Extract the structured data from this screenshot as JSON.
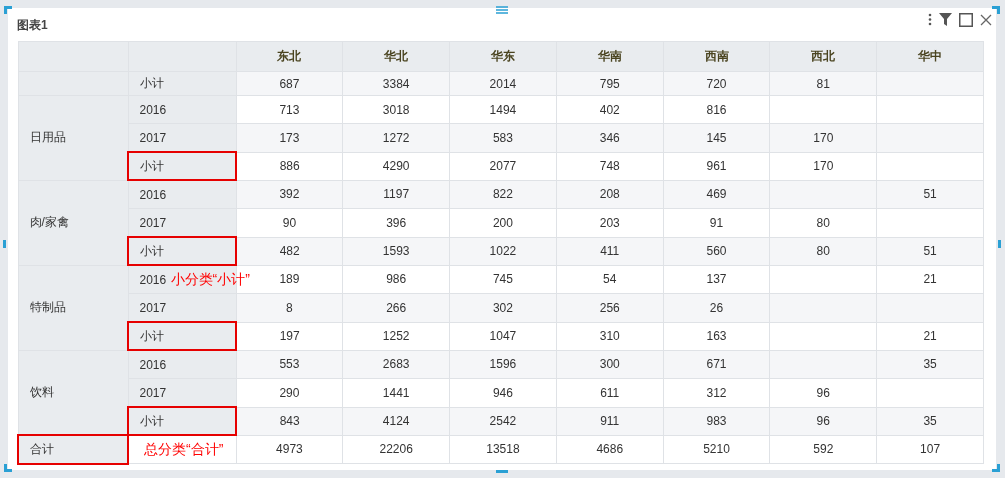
{
  "panel": {
    "title": "图表1"
  },
  "toolbar": [
    {
      "kind": "more"
    },
    {
      "kind": "filter"
    },
    {
      "kind": "maximize"
    },
    {
      "kind": "close"
    }
  ],
  "table": {
    "columns": [
      "东北",
      "华北",
      "华东",
      "华南",
      "西南",
      "西北",
      "华中"
    ],
    "groups": [
      {
        "rows": [
          {
            "label": "小计",
            "highlighted": false,
            "values": {
              "col_1": "687",
              "col_2": "3384",
              "col_3": "2014",
              "col_4": "795",
              "col_5": "720",
              "col_6": "81"
            }
          }
        ]
      },
      {
        "category": "日用品",
        "rows": [
          {
            "label": "2016",
            "highlighted": false,
            "values": {
              "col_1": "713",
              "col_2": "3018",
              "col_3": "1494",
              "col_4": "402",
              "col_5": "816"
            }
          },
          {
            "label": "2017",
            "highlighted": false,
            "values": {
              "col_1": "173",
              "col_2": "1272",
              "col_3": "583",
              "col_4": "346",
              "col_5": "145",
              "col_6": "170"
            }
          },
          {
            "label": "小计",
            "highlighted": true,
            "values": {
              "col_1": "886",
              "col_2": "4290",
              "col_3": "2077",
              "col_4": "748",
              "col_5": "961",
              "col_6": "170"
            }
          }
        ]
      },
      {
        "category": "肉/家禽",
        "rows": [
          {
            "label": "2016",
            "highlighted": false,
            "values": {
              "col_1": "392",
              "col_2": "1197",
              "col_3": "822",
              "col_4": "208",
              "col_5": "469",
              "col_7": "51"
            }
          },
          {
            "label": "2017",
            "highlighted": false,
            "values": {
              "col_1": "90",
              "col_2": "396",
              "col_3": "200",
              "col_4": "203",
              "col_5": "91",
              "col_6": "80"
            }
          },
          {
            "label": "小计",
            "highlighted": true,
            "values": {
              "col_1": "482",
              "col_2": "1593",
              "col_3": "1022",
              "col_4": "411",
              "col_5": "560",
              "col_6": "80",
              "col_7": "51"
            }
          }
        ]
      },
      {
        "category": "特制品",
        "rows": [
          {
            "label": "2016",
            "highlighted": false,
            "note": "小分类“小计”",
            "values": {
              "col_1": "189",
              "col_2": "986",
              "col_3": "745",
              "col_4": "54",
              "col_5": "137",
              "col_7": "21"
            }
          },
          {
            "label": "2017",
            "highlighted": false,
            "values": {
              "col_1": "8",
              "col_2": "266",
              "col_3": "302",
              "col_4": "256",
              "col_5": "26"
            }
          },
          {
            "label": "小计",
            "highlighted": true,
            "values": {
              "col_1": "197",
              "col_2": "1252",
              "col_3": "1047",
              "col_4": "310",
              "col_5": "163",
              "col_7": "21"
            }
          }
        ]
      },
      {
        "category": "饮料",
        "rows": [
          {
            "label": "2016",
            "highlighted": false,
            "values": {
              "col_1": "553",
              "col_2": "2683",
              "col_3": "1596",
              "col_4": "300",
              "col_5": "671",
              "col_7": "35"
            }
          },
          {
            "label": "2017",
            "highlighted": false,
            "values": {
              "col_1": "290",
              "col_2": "1441",
              "col_3": "946",
              "col_4": "611",
              "col_5": "312",
              "col_6": "96"
            }
          },
          {
            "label": "小计",
            "highlighted": true,
            "values": {
              "col_1": "843",
              "col_2": "4124",
              "col_3": "2542",
              "col_4": "911",
              "col_5": "983",
              "col_6": "96",
              "col_7": "35"
            }
          }
        ]
      }
    ],
    "total": {
      "label": "合计",
      "highlighted": true,
      "note": "总分类“合计”",
      "values": {
        "col_1": "4973",
        "col_2": "22206",
        "col_3": "13518",
        "col_4": "4686",
        "col_5": "5210",
        "col_6": "592",
        "col_7": "107"
      }
    }
  }
}
